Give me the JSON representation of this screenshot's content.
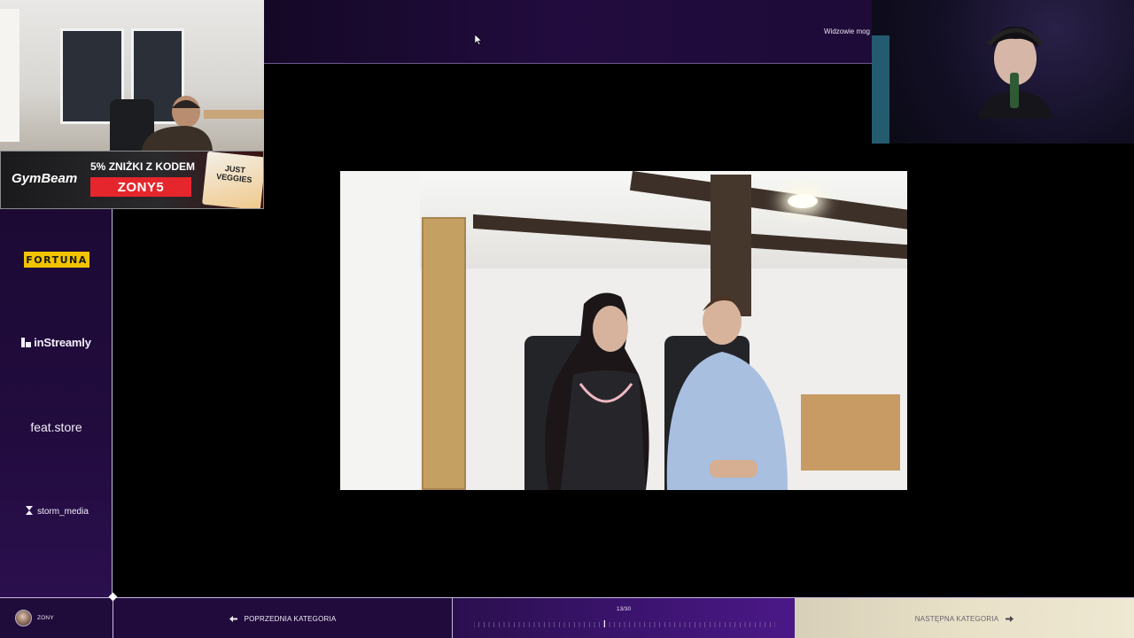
{
  "header": {
    "viewers_text": "Widzowie mog"
  },
  "sponsors": {
    "fortuna": "FORTUNA",
    "instreamly": "inStreamly",
    "featstore": "feat.store",
    "storm": "storm_media"
  },
  "banner": {
    "brand": "GymBeam",
    "promo_pct": "5%",
    "promo_text": "ZNIŻKI Z KODEM",
    "code": "ZONY5",
    "pack_label": "JUST VEGGIES"
  },
  "footer": {
    "profile_name": "ZONY",
    "prev_label": "POPRZEDNIA KATEGORIA",
    "next_label": "NASTĘPNA KATEGORIA",
    "progress_text": "13/30",
    "progress_current": 13,
    "progress_total": 30
  },
  "colors": {
    "accent_purple": "#220c3f",
    "next_gold": "#e8e0c7",
    "promo_red": "#e5262d",
    "fortuna_yellow": "#f2c400"
  }
}
